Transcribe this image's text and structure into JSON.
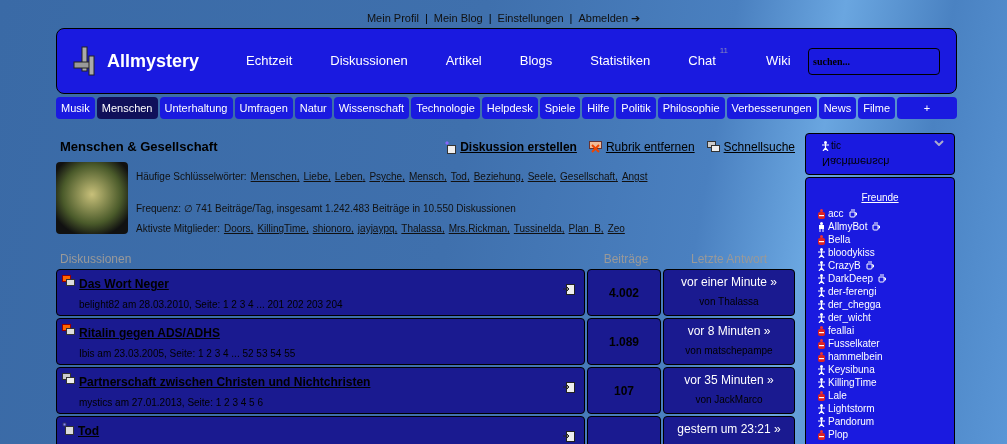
{
  "top_links": [
    "Mein Profil",
    "Mein Blog",
    "Einstellungen",
    "Abmelden ➔"
  ],
  "top_separator": "|",
  "header": {
    "logo": "Allmystery",
    "nav": [
      {
        "label": "Echtzeit"
      },
      {
        "label": "Diskussionen"
      },
      {
        "label": "Artikel"
      },
      {
        "label": "Blogs"
      },
      {
        "label": "Statistiken"
      },
      {
        "label": "Chat",
        "badge": "11"
      },
      {
        "label": "Wiki"
      }
    ],
    "search": {
      "placeholder": "suchen..."
    }
  },
  "categories": [
    {
      "label": "Musik",
      "selected": false
    },
    {
      "label": "Menschen",
      "selected": true
    },
    {
      "label": "Unterhaltung",
      "selected": false
    },
    {
      "label": "Umfragen",
      "selected": false
    },
    {
      "label": "Natur",
      "selected": false
    },
    {
      "label": "Wissenschaft",
      "selected": false
    },
    {
      "label": "Technologie",
      "selected": false
    },
    {
      "label": "Helpdesk",
      "selected": false
    },
    {
      "label": "Spiele",
      "selected": false
    },
    {
      "label": "Hilfe",
      "selected": false
    },
    {
      "label": "Politik",
      "selected": false
    },
    {
      "label": "Philosophie",
      "selected": false
    },
    {
      "label": "Verbesserungen",
      "selected": false
    },
    {
      "label": "News",
      "selected": false
    },
    {
      "label": "Filme",
      "selected": false
    },
    {
      "label": "+",
      "selected": false
    }
  ],
  "section": {
    "title": "Menschen & Gesellschaft",
    "actions": [
      {
        "kind": "create",
        "label": "Diskussion erstellen"
      },
      {
        "kind": "remove",
        "label": "Rubrik entfernen"
      },
      {
        "kind": "search",
        "label": "Schnellsuche"
      }
    ],
    "keywords_label": "Häufige Schlüsselwörter:",
    "keywords": [
      "Menschen",
      "Liebe",
      "Leben",
      "Psyche",
      "Mensch",
      "Tod",
      "Beziehung",
      "Seele",
      "Gesellschaft",
      "Angst"
    ],
    "list_separator": ",",
    "frequency": "Frequenz: ∅ 741 Beiträge/Tag, insgesamt 1.242.483 Beiträge in 10.550 Diskussionen",
    "members_label": "Aktivste Mitglieder:",
    "members": [
      "Doors",
      "KillingTime",
      "shionoro",
      "jayjaypq",
      "Thalassa",
      "Mrs.Rickman",
      "Tussinelda",
      "Plan_B",
      "Zeo"
    ]
  },
  "table": {
    "columns": [
      "Diskussionen",
      "Beiträge",
      "Letzte Antwort"
    ],
    "rows": [
      {
        "kind": "hot",
        "title": "Das Wort Neger",
        "meta": "belight82 am 28.03.2010, Seite: 1 2 3 4 ... 201 202 203 204",
        "marked": true,
        "posts": "4.002",
        "last": "vor einer Minute »",
        "by": "von Thalassa"
      },
      {
        "kind": "hot",
        "title": "Ritalin gegen ADS/ADHS",
        "meta": "Ibis am 23.03.2005, Seite: 1 2 3 4 ... 52 53 54 55",
        "marked": false,
        "posts": "1.089",
        "last": "vor 8 Minuten »",
        "by": "von matschepampe"
      },
      {
        "kind": "normal",
        "title": "Partnerschaft zwischen Christen und Nichtchristen",
        "meta": "mystics am 27.01.2013, Seite: 1 2 3 4 5 6",
        "marked": true,
        "posts": "107",
        "last": "vor 35 Minuten »",
        "by": "von JackMarco"
      },
      {
        "kind": "new",
        "title": "Tod",
        "marked": true,
        "last": "gestern um 23:21 »"
      }
    ]
  },
  "sidebar": {
    "user": "tic",
    "status": "Nachtmensch",
    "expanded": false,
    "friends_title": "Freunde",
    "friends": [
      {
        "name": "acc",
        "kind": "busy",
        "cup": true
      },
      {
        "name": "AllmyBot",
        "kind": "bot",
        "cup": true
      },
      {
        "name": "Bella",
        "kind": "busy",
        "cup": false
      },
      {
        "name": "bloodykiss",
        "kind": "online",
        "cup": false
      },
      {
        "name": "CrazyB",
        "kind": "online",
        "cup": true
      },
      {
        "name": "DarkDeep",
        "kind": "online",
        "cup": true
      },
      {
        "name": "der-ferengi",
        "kind": "online",
        "cup": false
      },
      {
        "name": "der_chegga",
        "kind": "online",
        "cup": false
      },
      {
        "name": "der_wicht",
        "kind": "online",
        "cup": false
      },
      {
        "name": "feallai",
        "kind": "busy",
        "cup": false
      },
      {
        "name": "Fusselkater",
        "kind": "busy",
        "cup": false
      },
      {
        "name": "hammelbein",
        "kind": "busy",
        "cup": false
      },
      {
        "name": "Keysibuna",
        "kind": "online",
        "cup": false
      },
      {
        "name": "KillingTime",
        "kind": "online",
        "cup": false
      },
      {
        "name": "Lale",
        "kind": "busy",
        "cup": false
      },
      {
        "name": "Lightstorm",
        "kind": "online",
        "cup": false
      },
      {
        "name": "Pandorum",
        "kind": "online",
        "cup": false
      },
      {
        "name": "Plop",
        "kind": "busy",
        "cup": false
      }
    ]
  }
}
